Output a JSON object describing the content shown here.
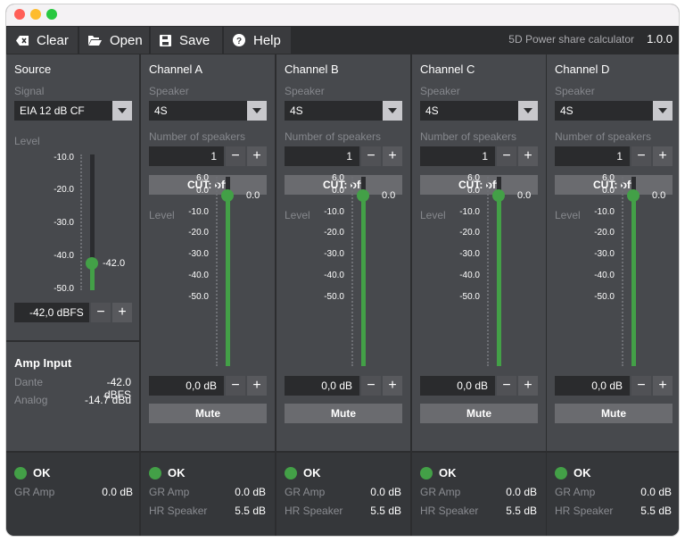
{
  "toolbar": {
    "clear_label": "Clear",
    "open_label": "Open",
    "save_label": "Save",
    "help_label": "Help",
    "app_name": "5D Power share calculator",
    "version": "1.0.0"
  },
  "colors": {
    "accent": "#43a047",
    "close": "#ff5f57",
    "minimize": "#febc2e",
    "zoom": "#28c840"
  },
  "source": {
    "title": "Source",
    "signal_label": "Signal",
    "signal_value": "EIA 12 dB CF",
    "level_label": "Level",
    "ticks": [
      "-10.0",
      "-20.0",
      "-30.0",
      "-40.0",
      "-50.0"
    ],
    "level_readout": "-42.0",
    "level_value": "-42,0 dBFS",
    "level_fraction": 0.2
  },
  "amp_input": {
    "title": "Amp Input",
    "dante_label": "Dante",
    "dante_value": "-42.0 dBFS",
    "analog_label": "Analog",
    "analog_value": "-14.7 dBu"
  },
  "channel_common": {
    "speaker_label": "Speaker",
    "num_speakers_label": "Number of speakers",
    "level_label": "Level",
    "ticks": [
      "6.0",
      "0.0",
      "-10.0",
      "-20.0",
      "-30.0",
      "-40.0",
      "-50.0"
    ],
    "minus": "−",
    "plus": "+"
  },
  "channels": [
    {
      "name": "Channel A",
      "speaker": "4S",
      "count": "1",
      "cut": "CUT: off",
      "level_readout": "0.0",
      "level_value": "0,0 dB",
      "mute": "Mute",
      "level_fraction": 0.9
    },
    {
      "name": "Channel B",
      "speaker": "4S",
      "count": "1",
      "cut": "CUT: off",
      "level_readout": "0.0",
      "level_value": "0,0 dB",
      "mute": "Mute",
      "level_fraction": 0.9
    },
    {
      "name": "Channel C",
      "speaker": "4S",
      "count": "1",
      "cut": "CUT: off",
      "level_readout": "0.0",
      "level_value": "0,0 dB",
      "mute": "Mute",
      "level_fraction": 0.9
    },
    {
      "name": "Channel D",
      "speaker": "4S",
      "count": "1",
      "cut": "CUT: off",
      "level_readout": "0.0",
      "level_value": "0,0 dB",
      "mute": "Mute",
      "level_fraction": 0.9
    }
  ],
  "status": {
    "ok": "OK",
    "gr_amp_label": "GR Amp",
    "hr_speaker_label": "HR Speaker",
    "source_gr_value": "0.0 dB",
    "channels": [
      {
        "gr_value": "0.0 dB",
        "hr_value": "5.5 dB"
      },
      {
        "gr_value": "0.0 dB",
        "hr_value": "5.5 dB"
      },
      {
        "gr_value": "0.0 dB",
        "hr_value": "5.5 dB"
      },
      {
        "gr_value": "0.0 dB",
        "hr_value": "5.5 dB"
      }
    ]
  }
}
